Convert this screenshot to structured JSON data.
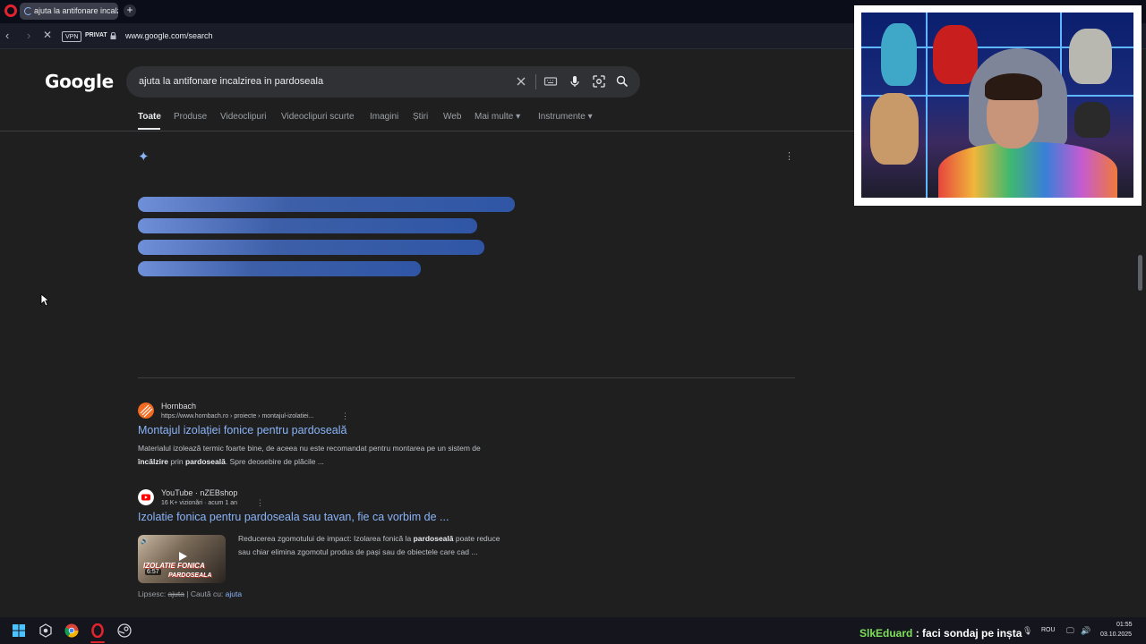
{
  "browser": {
    "tab_title": "ajuta la antifonare incalzi",
    "new_tab_label": "+",
    "vpn_label": "VPN",
    "private_label": "PRIVAT",
    "url": "www.google.com/search"
  },
  "google": {
    "logo": "Google",
    "query": "ajuta la antifonare incalzirea in pardoseala",
    "tabs": [
      {
        "label": "Toate",
        "active": true
      },
      {
        "label": "Produse"
      },
      {
        "label": "Videoclipuri"
      },
      {
        "label": "Videoclipuri scurte"
      },
      {
        "label": "Imagini"
      },
      {
        "label": "Știri"
      },
      {
        "label": "Web"
      },
      {
        "label": "Mai multe ▾"
      },
      {
        "label": "Instrumente ▾"
      }
    ]
  },
  "results": [
    {
      "site": "Hornbach",
      "url": "https://www.hornbach.ro › proiecte › montajul-izolatiei...",
      "title": "Montajul izolației fonice pentru pardoseală",
      "snippet_line1": "Materialul izolează termic foarte bine, de aceea nu este recomandat pentru montarea pe un sistem de",
      "snippet_line2_b1": "încălzire",
      "snippet_line2_t1": " prin ",
      "snippet_line2_b2": "pardoseală",
      "snippet_line2_t2": ". Spre deosebire de plăcile ..."
    },
    {
      "site": "YouTube · nZEBshop",
      "url": "16 K+ vizionări · acum 1 an",
      "title": "Izolatie fonica pentru pardoseala sau tavan, fie ca vorbim de ...",
      "snippet_line1_t1": "Reducerea zgomotului de impact: Izolarea fonică la ",
      "snippet_line1_b1": "pardoseală",
      "snippet_line1_t2": " poate reduce",
      "snippet_line2": "sau chiar elimina zgomotul produs de pași sau de obiectele care cad ...",
      "thumb_text": "IZOLATIE FONICA",
      "thumb_text2": "PARDOSEALA",
      "duration": "6:57"
    }
  ],
  "missing": {
    "prefix": "Lipsesc: ",
    "struck": "ajuta",
    "middle": " | Caută cu: ",
    "link": "ajuta"
  },
  "taskbar": {
    "chat_user": "SlkEduard",
    "chat_text": " : faci sondaj pe inșta",
    "language": "ROU",
    "time": "01:55",
    "date": "03.10.2025"
  },
  "colors": {
    "accent_link": "#8ab4f8",
    "opera_red": "#e0232c",
    "chat_user": "#7ee05a"
  }
}
